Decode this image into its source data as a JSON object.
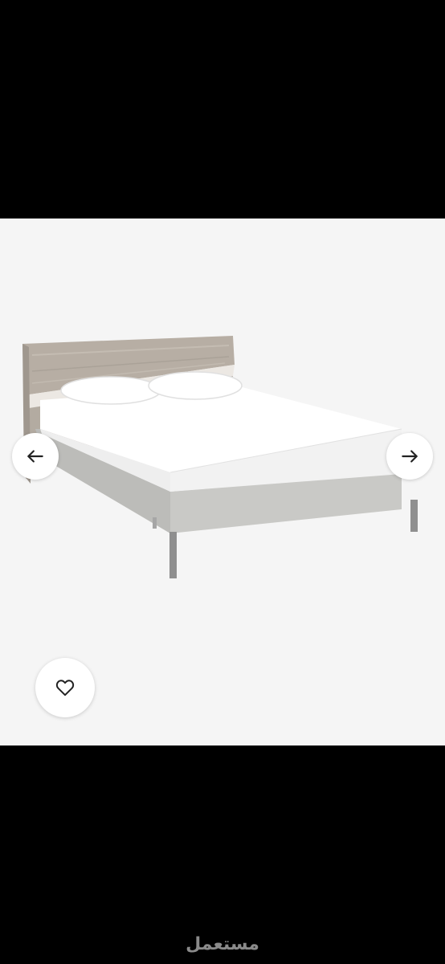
{
  "gallery": {
    "image_alt": "bed",
    "prev_icon": "arrow-left-icon",
    "next_icon": "arrow-right-icon",
    "favorite_icon": "heart-icon"
  },
  "watermark": {
    "text": "مستعمل"
  },
  "colors": {
    "background": "#000000",
    "gallery_bg": "#f5f5f5",
    "button_bg": "#ffffff",
    "icon": "#222222",
    "headboard": "#b9b0a6",
    "frame": "#c9c9c6",
    "mattress": "#ffffff",
    "legs": "#8f8f8f",
    "watermark": "#8a8a8a"
  }
}
